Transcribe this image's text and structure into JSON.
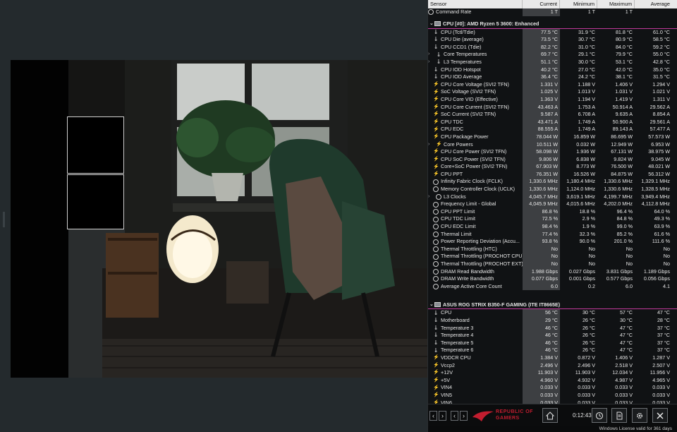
{
  "columns": {
    "sensor": "Sensor",
    "current": "Current",
    "minimum": "Minimum",
    "maximum": "Maximum",
    "average": "Average"
  },
  "top_row": {
    "name": "Command Rate",
    "cur": "1 T",
    "min": "1 T",
    "max": "1 T",
    "avg": ""
  },
  "cpu_group": {
    "title": "CPU [#0]: AMD Ryzen 5 3600: Enhanced",
    "rows": [
      {
        "name": "CPU (Tctl/Tdie)",
        "icon": "therm",
        "cur": "77.5 °C",
        "min": "31.9 °C",
        "max": "81.8 °C",
        "avg": "61.0 °C"
      },
      {
        "name": "CPU Die (average)",
        "icon": "therm",
        "cur": "73.5 °C",
        "min": "30.7 °C",
        "max": "80.9 °C",
        "avg": "58.5 °C"
      },
      {
        "name": "CPU CCD1 (Tdie)",
        "icon": "therm",
        "cur": "82.2 °C",
        "min": "31.0 °C",
        "max": "84.0 °C",
        "avg": "59.2 °C"
      },
      {
        "name": "Core Temperatures",
        "icon": "therm",
        "exp": true,
        "indent": 1,
        "cur": "69.7 °C",
        "min": "29.1 °C",
        "max": "79.9 °C",
        "avg": "55.0 °C"
      },
      {
        "name": "L3 Temperatures",
        "icon": "therm",
        "exp": true,
        "indent": 1,
        "cur": "51.1 °C",
        "min": "30.0 °C",
        "max": "53.1 °C",
        "avg": "42.8 °C"
      },
      {
        "name": "CPU IOD Hotspot",
        "icon": "therm",
        "cur": "40.2 °C",
        "min": "27.0 °C",
        "max": "42.0 °C",
        "avg": "35.0 °C"
      },
      {
        "name": "CPU IOD Average",
        "icon": "therm",
        "cur": "36.4 °C",
        "min": "24.2 °C",
        "max": "38.1 °C",
        "avg": "31.5 °C"
      },
      {
        "name": "CPU Core Voltage (SVI2 TFN)",
        "icon": "bolt",
        "cur": "1.331 V",
        "min": "1.188 V",
        "max": "1.406 V",
        "avg": "1.294 V"
      },
      {
        "name": "SoC Voltage (SVI2 TFN)",
        "icon": "bolt",
        "cur": "1.025 V",
        "min": "1.013 V",
        "max": "1.031 V",
        "avg": "1.021 V"
      },
      {
        "name": "CPU Core VID (Effective)",
        "icon": "bolt",
        "cur": "1.363 V",
        "min": "1.194 V",
        "max": "1.419 V",
        "avg": "1.311 V"
      },
      {
        "name": "CPU Core Current (SVI2 TFN)",
        "icon": "bolt",
        "cur": "43.463 A",
        "min": "1.753 A",
        "max": "50.914 A",
        "avg": "29.562 A"
      },
      {
        "name": "SoC Current (SVI2 TFN)",
        "icon": "bolt",
        "cur": "9.587 A",
        "min": "6.708 A",
        "max": "9.635 A",
        "avg": "8.854 A"
      },
      {
        "name": "CPU TDC",
        "icon": "bolt",
        "cur": "43.471 A",
        "min": "1.749 A",
        "max": "50.900 A",
        "avg": "29.561 A"
      },
      {
        "name": "CPU EDC",
        "icon": "bolt",
        "cur": "88.555 A",
        "min": "1.749 A",
        "max": "89.143 A",
        "avg": "57.477 A"
      },
      {
        "name": "CPU Package Power",
        "icon": "bolt",
        "cur": "78.044 W",
        "min": "16.859 W",
        "max": "86.695 W",
        "avg": "57.573 W"
      },
      {
        "name": "Core Powers",
        "icon": "bolt",
        "exp": true,
        "indent": 1,
        "cur": "10.511 W",
        "min": "0.032 W",
        "max": "12.949 W",
        "avg": "6.953 W"
      },
      {
        "name": "CPU Core Power (SVI2 TFN)",
        "icon": "bolt",
        "cur": "58.098 W",
        "min": "1.936 W",
        "max": "67.131 W",
        "avg": "38.975 W"
      },
      {
        "name": "CPU SoC Power (SVI2 TFN)",
        "icon": "bolt",
        "cur": "9.806 W",
        "min": "6.838 W",
        "max": "9.824 W",
        "avg": "9.045 W"
      },
      {
        "name": "Core+SoC Power (SVI2 TFN)",
        "icon": "bolt",
        "cur": "67.903 W",
        "min": "8.773 W",
        "max": "76.500 W",
        "avg": "48.021 W"
      },
      {
        "name": "CPU PPT",
        "icon": "bolt",
        "cur": "76.351 W",
        "min": "16.526 W",
        "max": "84.875 W",
        "avg": "56.312 W"
      },
      {
        "name": "Infinity Fabric Clock (FCLK)",
        "icon": "clk",
        "cur": "1,330.6 MHz",
        "min": "1,180.4 MHz",
        "max": "1,330.6 MHz",
        "avg": "1,329.1 MHz"
      },
      {
        "name": "Memory Controller Clock (UCLK)",
        "icon": "clk",
        "cur": "1,330.6 MHz",
        "min": "1,124.0 MHz",
        "max": "1,330.6 MHz",
        "avg": "1,328.5 MHz"
      },
      {
        "name": "L3 Clocks",
        "icon": "clk",
        "exp": true,
        "indent": 1,
        "cur": "4,045.7 MHz",
        "min": "3,619.1 MHz",
        "max": "4,199.7 MHz",
        "avg": "3,949.4 MHz"
      },
      {
        "name": "Frequency Limit - Global",
        "icon": "clk",
        "cur": "4,045.9 MHz",
        "min": "4,015.6 MHz",
        "max": "4,202.0 MHz",
        "avg": "4,112.8 MHz"
      },
      {
        "name": "CPU PPT Limit",
        "icon": "clk",
        "cur": "86.8 %",
        "min": "18.8 %",
        "max": "96.4 %",
        "avg": "64.0 %"
      },
      {
        "name": "CPU TDC Limit",
        "icon": "clk",
        "cur": "72.5 %",
        "min": "2.9 %",
        "max": "84.8 %",
        "avg": "49.3 %"
      },
      {
        "name": "CPU EDC Limit",
        "icon": "clk",
        "cur": "98.4 %",
        "min": "1.9 %",
        "max": "99.0 %",
        "avg": "63.9 %"
      },
      {
        "name": "Thermal Limit",
        "icon": "clk",
        "cur": "77.4 %",
        "min": "32.3 %",
        "max": "85.2 %",
        "avg": "61.6 %"
      },
      {
        "name": "Power Reporting Deviation (Accu...",
        "icon": "clk",
        "cur": "93.8 %",
        "min": "90.0 %",
        "max": "201.0 %",
        "avg": "111.6 %"
      },
      {
        "name": "Thermal Throttling (HTC)",
        "icon": "clk",
        "cur": "No",
        "min": "No",
        "max": "No",
        "avg": "No"
      },
      {
        "name": "Thermal Throttling (PROCHOT CPU)",
        "icon": "clk",
        "cur": "No",
        "min": "No",
        "max": "No",
        "avg": "No"
      },
      {
        "name": "Thermal Throttling (PROCHOT EXT)",
        "icon": "clk",
        "cur": "No",
        "min": "No",
        "max": "No",
        "avg": "No"
      },
      {
        "name": "DRAM Read Bandwidth",
        "icon": "clk",
        "cur": "1.988 Gbps",
        "min": "0.027 Gbps",
        "max": "3.831 Gbps",
        "avg": "1.189 Gbps"
      },
      {
        "name": "DRAM Write Bandwidth",
        "icon": "clk",
        "cur": "0.077 Gbps",
        "min": "0.001 Gbps",
        "max": "0.577 Gbps",
        "avg": "0.056 Gbps"
      },
      {
        "name": "Average Active Core Count",
        "icon": "clk",
        "cur": "6.0",
        "min": "0.2",
        "max": "6.0",
        "avg": "4.1"
      }
    ]
  },
  "mb_group": {
    "title": "ASUS ROG STRIX B350-F GAMING (ITE IT8665E)",
    "rows": [
      {
        "name": "CPU",
        "icon": "therm",
        "cur": "56 °C",
        "min": "30 °C",
        "max": "57 °C",
        "avg": "47 °C"
      },
      {
        "name": "Motherboard",
        "icon": "therm",
        "cur": "29 °C",
        "min": "26 °C",
        "max": "30 °C",
        "avg": "28 °C"
      },
      {
        "name": "Temperature 3",
        "icon": "therm",
        "cur": "46 °C",
        "min": "26 °C",
        "max": "47 °C",
        "avg": "37 °C"
      },
      {
        "name": "Temperature 4",
        "icon": "therm",
        "cur": "46 °C",
        "min": "26 °C",
        "max": "47 °C",
        "avg": "37 °C"
      },
      {
        "name": "Temperature 5",
        "icon": "therm",
        "cur": "46 °C",
        "min": "26 °C",
        "max": "47 °C",
        "avg": "37 °C"
      },
      {
        "name": "Temperature 6",
        "icon": "therm",
        "cur": "46 °C",
        "min": "26 °C",
        "max": "47 °C",
        "avg": "37 °C"
      },
      {
        "name": "VDDCR CPU",
        "icon": "bolt",
        "cur": "1.384 V",
        "min": "0.872 V",
        "max": "1.406 V",
        "avg": "1.287 V"
      },
      {
        "name": "Vccp2",
        "icon": "bolt",
        "cur": "2.496 V",
        "min": "2.496 V",
        "max": "2.518 V",
        "avg": "2.507 V"
      },
      {
        "name": "+12V",
        "icon": "bolt",
        "cur": "11.903 V",
        "min": "11.903 V",
        "max": "12.034 V",
        "avg": "11.956 V"
      },
      {
        "name": "+5V",
        "icon": "bolt",
        "cur": "4.960 V",
        "min": "4.932 V",
        "max": "4.987 V",
        "avg": "4.965 V"
      },
      {
        "name": "VIN4",
        "icon": "bolt",
        "cur": "0.033 V",
        "min": "0.033 V",
        "max": "0.033 V",
        "avg": "0.033 V"
      },
      {
        "name": "VIN5",
        "icon": "bolt",
        "cur": "0.033 V",
        "min": "0.033 V",
        "max": "0.033 V",
        "avg": "0.033 V"
      },
      {
        "name": "VIN6",
        "icon": "bolt",
        "cur": "0.033 V",
        "min": "0.033 V",
        "max": "0.033 V",
        "avg": "0.033 V"
      }
    ]
  },
  "footer": {
    "brand_line1": "REPUBLIC OF",
    "brand_line2": "GAMERS",
    "elapsed": "0:12:43",
    "status": "Windows License valid for 361 days"
  },
  "colors": {
    "group_accent": "#c23a9b",
    "brand_red": "#c21d2f"
  }
}
